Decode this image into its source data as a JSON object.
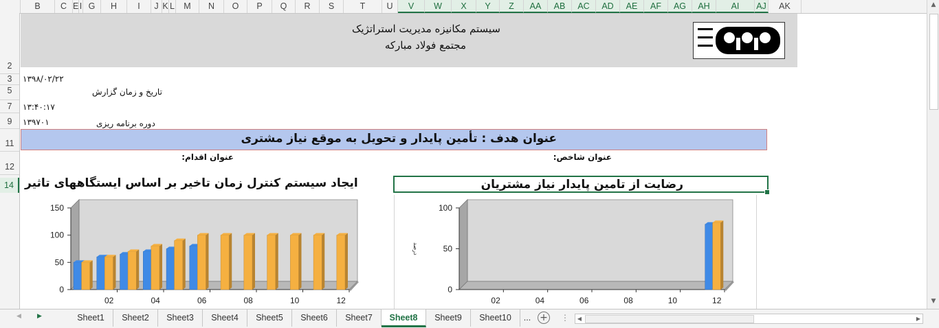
{
  "columns": [
    "B",
    "C",
    "E",
    "I",
    "G",
    "H",
    "I",
    "J",
    "K",
    "L",
    "M",
    "N",
    "O",
    "P",
    "Q",
    "R",
    "S",
    "T",
    "U",
    "V",
    "W",
    "X",
    "Y",
    "Z",
    "AA",
    "AB",
    "AC",
    "AD",
    "AE",
    "AF",
    "AG",
    "AH",
    "AI",
    "AJ",
    "AK"
  ],
  "rows": [
    "2",
    "3",
    "5",
    "7",
    "9",
    "11",
    "12",
    "14"
  ],
  "header": {
    "title_line1": "سیستم مکانیزه مدیریت استراتژیک",
    "title_line2": "مجتمع فولاد مبارکه",
    "logo_text": "مجتمع فولاد مبارکه"
  },
  "report": {
    "date_value": "۱۳۹۸/۰۲/۲۲",
    "date_label": "تاریخ و زمان گزارش",
    "time_value": "۱۳:۴۰:۱۷",
    "period_value": "۱۳۹۷۰۱",
    "period_label": "دوره برنامه ریزی"
  },
  "goal_title": "عنوان هدف : تأمین پایدار و تحویل به موقع نیاز مشتری",
  "action_label": "عنوان اقدام:",
  "indicator_label": "عنوان شاخص:",
  "action_title": "ایجاد سیستم کنترل زمان تاخیر بر اساس ایستگاههای تاثیر",
  "indicator_title": "رضایت از تامین پایدار نیاز مشتریان",
  "chart_data": [
    {
      "type": "bar",
      "x_tick_labels": [
        "02",
        "04",
        "06",
        "08",
        "10",
        "12"
      ],
      "ylim": [
        0,
        150
      ],
      "yticks": [
        0,
        50,
        100,
        150
      ],
      "series": [
        {
          "values": [
            50,
            60,
            65,
            70,
            75,
            80,
            null,
            null,
            null,
            null,
            null,
            null
          ],
          "color": "#3f8ae6"
        },
        {
          "values": [
            50,
            60,
            70,
            80,
            90,
            100,
            100,
            100,
            100,
            100,
            100,
            100
          ],
          "color": "#f5b041"
        }
      ]
    },
    {
      "type": "bar",
      "x_tick_labels": [
        "02",
        "04",
        "06",
        "08",
        "10",
        "12"
      ],
      "ylim": [
        0,
        100
      ],
      "yticks": [
        0,
        50,
        100
      ],
      "ylabel": "درصد",
      "series": [
        {
          "values": [
            null,
            null,
            null,
            null,
            null,
            null,
            null,
            null,
            null,
            null,
            null,
            80
          ],
          "color": "#3f8ae6"
        },
        {
          "values": [
            null,
            null,
            null,
            null,
            null,
            null,
            null,
            null,
            null,
            null,
            null,
            82
          ],
          "color": "#f5b041"
        }
      ]
    }
  ],
  "sheet_tabs": [
    "Sheet1",
    "Sheet2",
    "Sheet3",
    "Sheet4",
    "Sheet5",
    "Sheet6",
    "Sheet7",
    "Sheet8",
    "Sheet9",
    "Sheet10",
    "..."
  ],
  "active_tab": "Sheet8"
}
